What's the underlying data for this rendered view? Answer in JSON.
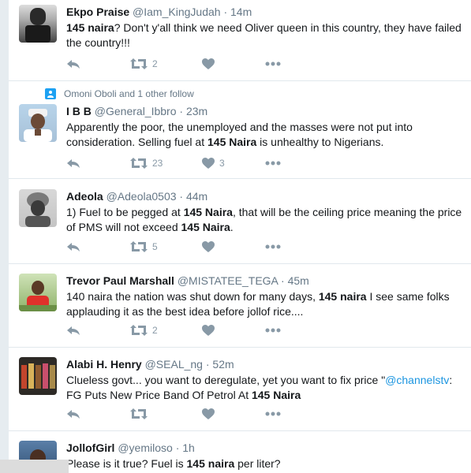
{
  "tweets": [
    {
      "name": "Ekpo Praise",
      "handle": "@Iam_KingJudah",
      "time": "14m",
      "parts": [
        {
          "t": "145 naira",
          "b": true
        },
        {
          "t": "? Don't y'all think we need Oliver queen in this country, they have failed the country!!!"
        }
      ],
      "retweets": "2",
      "likes": ""
    },
    {
      "social_context": "Omoni Oboli and 1 other follow",
      "name": "I B B",
      "handle": "@General_Ibbro",
      "time": "23m",
      "parts": [
        {
          "t": "Apparently the poor, the unemployed and the masses were not put into consideration. Selling fuel at "
        },
        {
          "t": "145 Naira",
          "b": true
        },
        {
          "t": " is unhealthy to Nigerians."
        }
      ],
      "retweets": "23",
      "likes": "3"
    },
    {
      "name": "Adeola",
      "handle": "@Adeola0503",
      "time": "44m",
      "parts": [
        {
          "t": "1) Fuel to be pegged at "
        },
        {
          "t": "145 Naira",
          "b": true
        },
        {
          "t": ", that will be the ceiling price meaning the price of PMS will not exceed "
        },
        {
          "t": "145 Naira",
          "b": true
        },
        {
          "t": "."
        }
      ],
      "retweets": "5",
      "likes": ""
    },
    {
      "name": "Trevor Paul Marshall",
      "handle": "@MISTATEE_TEGA",
      "time": "45m",
      "parts": [
        {
          "t": "140 naira the nation was shut down for many days, "
        },
        {
          "t": "145 naira",
          "b": true
        },
        {
          "t": " I see same folks applauding it as the best idea before jollof rice...."
        }
      ],
      "retweets": "2",
      "likes": ""
    },
    {
      "name": "Alabi H. Henry",
      "handle": "@SEAL_ng",
      "time": "52m",
      "parts": [
        {
          "t": "Clueless govt... you want to deregulate, yet you want to fix price \""
        },
        {
          "t": "@channelstv",
          "link": true
        },
        {
          "t": ": FG Puts New Price Band Of Petrol At "
        },
        {
          "t": "145 Naira",
          "b": true
        }
      ],
      "retweets": "",
      "likes": ""
    },
    {
      "name": "JollofGirl",
      "handle": "@yemiloso",
      "time": "1h",
      "parts": [
        {
          "t": "Please is it true? Fuel is "
        },
        {
          "t": "145 naira",
          "b": true
        },
        {
          "t": " per liter?"
        }
      ],
      "retweets": "",
      "likes": ""
    }
  ],
  "icons": {
    "reply": "reply-icon",
    "retweet": "retweet-icon",
    "like": "heart-icon",
    "more": "more-icon",
    "social": "follow-icon"
  },
  "colors": {
    "action": "#8899a6",
    "link": "#1b95e0",
    "separator": "#e1e8ed",
    "muted": "#657786"
  }
}
